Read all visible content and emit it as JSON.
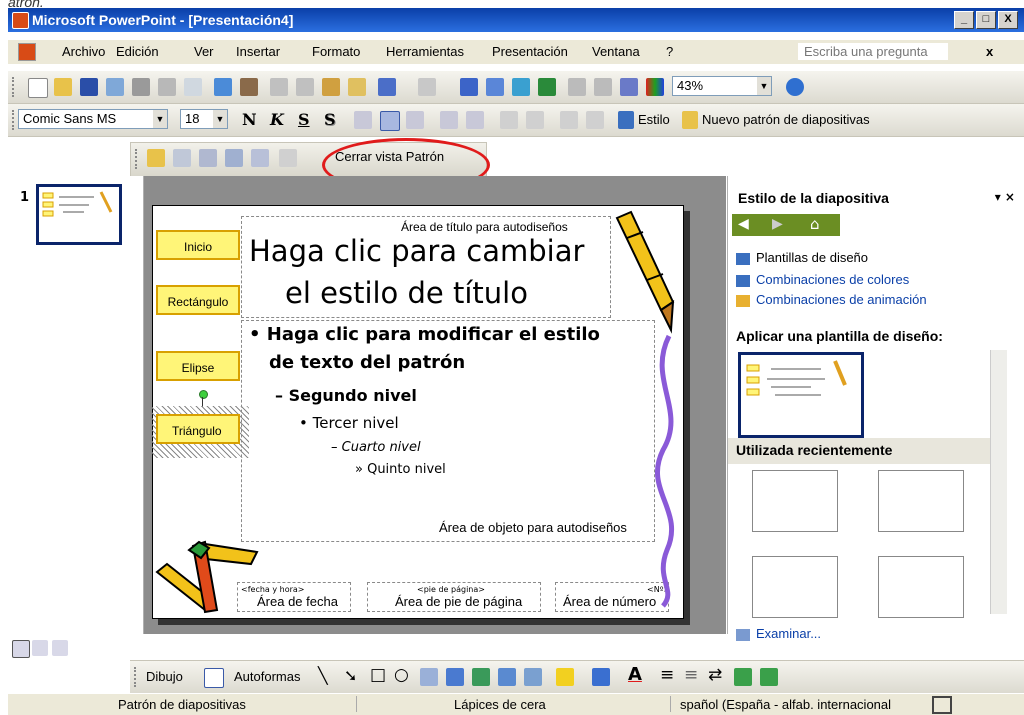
{
  "caption_fragment": "atron.",
  "window": {
    "title": "Microsoft PowerPoint - [Presentación4]",
    "buttons": [
      "_",
      "□",
      "X"
    ]
  },
  "menu": {
    "items": [
      "Archivo",
      "Edición",
      "Ver",
      "Insertar",
      "Formato",
      "Herramientas",
      "Presentación",
      "Ventana",
      "?"
    ],
    "ask_placeholder": "Escriba una pregunta",
    "close": "x"
  },
  "standard_toolbar": {
    "zoom": "43%"
  },
  "format_toolbar": {
    "font": "Comic Sans MS",
    "size": "18",
    "bold": "N",
    "italic": "K",
    "underline": "S",
    "shadow": "S",
    "estilo": "Estilo",
    "nuevo_patron": "Nuevo patrón de diapositivas"
  },
  "master_toolbar": {
    "close_label": "Cerrar vista Patrón"
  },
  "thumbnail": {
    "number": "1"
  },
  "slide": {
    "buttons": [
      "Inicio",
      "Rectángulo",
      "Elipse",
      "Triángulo"
    ],
    "title_area_label": "Área de título para autodiseños",
    "title_line1": "Haga clic para cambiar",
    "title_line2": "el estilo de título",
    "body_level1_a": "• Haga clic para modificar el estilo",
    "body_level1_b": "de texto del patrón",
    "body_level2": "– Segundo nivel",
    "body_level3": "• Tercer nivel",
    "body_level4": "– Cuarto nivel",
    "body_level5": "» Quinto nivel",
    "object_area_label": "Área de objeto para autodiseños",
    "date_small": "<fecha y hora>",
    "date_label": "Área de fecha",
    "footer_small": "<pie de página>",
    "footer_label": "Área de pie de página",
    "number_small": "<Nº>",
    "number_label": "Área de número"
  },
  "task_pane": {
    "title": "Estilo de la diapositiva",
    "links": [
      "Plantillas de diseño",
      "Combinaciones de colores",
      "Combinaciones de animación"
    ],
    "apply_heading": "Aplicar una plantilla de diseño:",
    "recent_heading": "Utilizada recientemente",
    "browse": "Examinar..."
  },
  "drawing_toolbar": {
    "draw": "Dibujo",
    "autoshapes": "Autoformas"
  },
  "status": {
    "view": "Patrón de diapositivas",
    "design": "Lápices de cera",
    "language": "spañol (España - alfab. internacional"
  },
  "colors": {
    "accent_red": "#e01b1b",
    "title_blue": "#0a3fa8",
    "button_yellow": "#fff578"
  }
}
